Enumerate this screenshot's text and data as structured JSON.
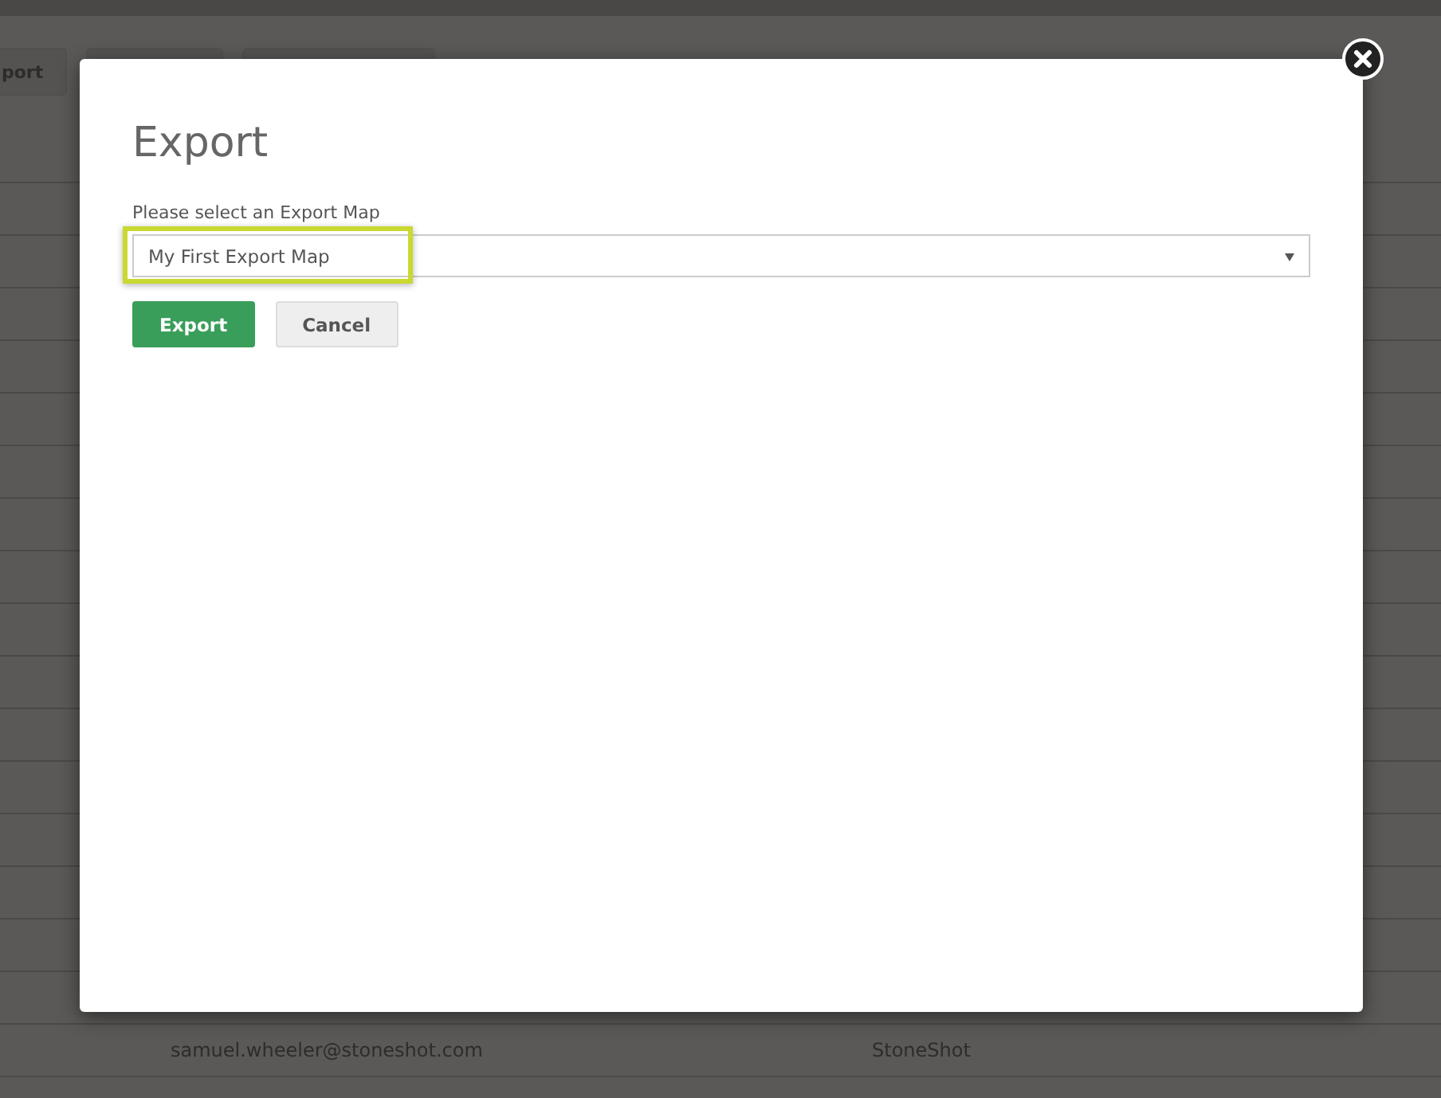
{
  "background": {
    "toolbar_buttons": [
      {
        "label": "port"
      }
    ],
    "rows": [
      {
        "email": "samuel.wheeler@stoneshot.com",
        "company": "StoneShot"
      }
    ]
  },
  "modal": {
    "title": "Export",
    "field_label": "Please select an Export Map",
    "select": {
      "value": "My First Export Map",
      "highlighted": true
    },
    "buttons": [
      {
        "label": "Export",
        "kind": "primary"
      },
      {
        "label": "Cancel",
        "kind": "secondary"
      }
    ]
  }
}
